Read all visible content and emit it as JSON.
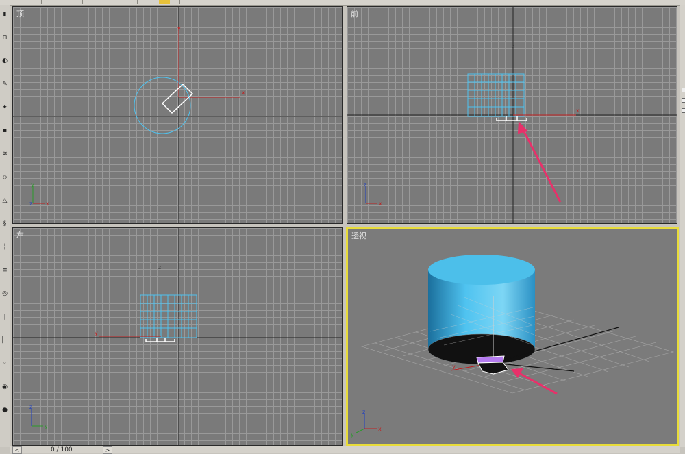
{
  "viewports": {
    "top": {
      "label": "顶"
    },
    "front": {
      "label": "前"
    },
    "left": {
      "label": "左"
    },
    "perspective": {
      "label": "透视"
    }
  },
  "axis_labels": {
    "x": "x",
    "y": "y",
    "z": "z"
  },
  "time_slider": {
    "frame_text": "0 / 100",
    "prev_label": "<",
    "next_label": ">"
  },
  "left_toolbar": {
    "tools": [
      "▮",
      "⊓",
      "◐",
      "✎",
      "✦",
      "▪",
      "≋",
      "◇",
      "△",
      "§",
      "╎",
      "≡",
      "◎",
      "∣",
      "▏",
      "◦",
      "◉",
      "●"
    ]
  },
  "colors": {
    "viewport_bg": "#7a7a7a",
    "grid": "#999999",
    "active_border": "#e8dc3a",
    "selection_blue": "#4fc3f0",
    "annotation_arrow": "#e8306a",
    "light_purple": "#b57cf0"
  }
}
